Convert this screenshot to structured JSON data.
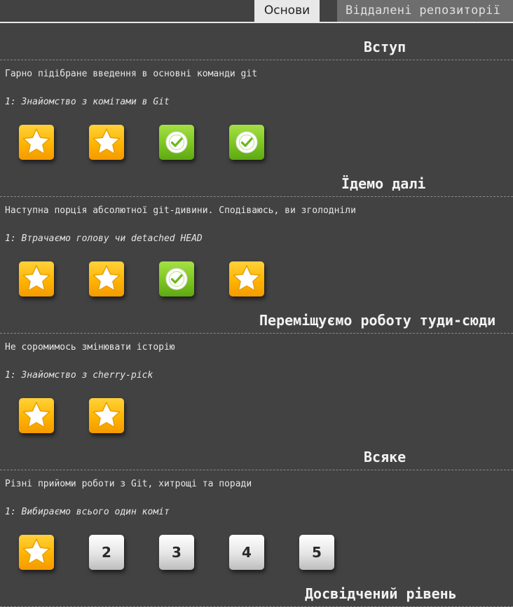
{
  "tabs": [
    {
      "label": "Основи",
      "active": true
    },
    {
      "label": "Віддалені репозиторії",
      "active": false
    }
  ],
  "sections": [
    {
      "title": "Вступ",
      "description": "Гарно підібране введення в основні команди git",
      "subtitle": "1: Знайомство з комітами в Git",
      "levels": [
        {
          "type": "star",
          "icon": "star-icon"
        },
        {
          "type": "star",
          "icon": "star-icon"
        },
        {
          "type": "done",
          "icon": "checkmark-icon"
        },
        {
          "type": "done",
          "icon": "checkmark-icon"
        }
      ]
    },
    {
      "title": "Їдемо далі",
      "description": "Наступна порція абсолютної git-дивини. Сподіваюсь, ви зголодніли",
      "subtitle": "1: Втрачаємо голову чи detached HEAD",
      "levels": [
        {
          "type": "star",
          "icon": "star-icon"
        },
        {
          "type": "star",
          "icon": "star-icon"
        },
        {
          "type": "done",
          "icon": "checkmark-icon"
        },
        {
          "type": "star",
          "icon": "star-icon"
        }
      ]
    },
    {
      "title": "Переміщуємо роботу туди-сюди",
      "description": "Не соромимось змінювати історію",
      "subtitle": "1: Знайомство з cherry-pick",
      "levels": [
        {
          "type": "star",
          "icon": "star-icon"
        },
        {
          "type": "star",
          "icon": "star-icon"
        }
      ]
    },
    {
      "title": "Всяке",
      "description": "Різні прийоми роботи з Git, хитрощі та поради",
      "subtitle": "1: Вибираємо всього один коміт",
      "levels": [
        {
          "type": "star",
          "icon": "star-icon"
        },
        {
          "type": "num",
          "label": "2"
        },
        {
          "type": "num",
          "label": "3"
        },
        {
          "type": "num",
          "label": "4"
        },
        {
          "type": "num",
          "label": "5"
        }
      ]
    },
    {
      "title": "Досвідчений рівень"
    }
  ],
  "colors": {
    "background": "#424242",
    "star": "#ffb400",
    "done": "#7cc520",
    "locked": "#e4e4e4"
  }
}
